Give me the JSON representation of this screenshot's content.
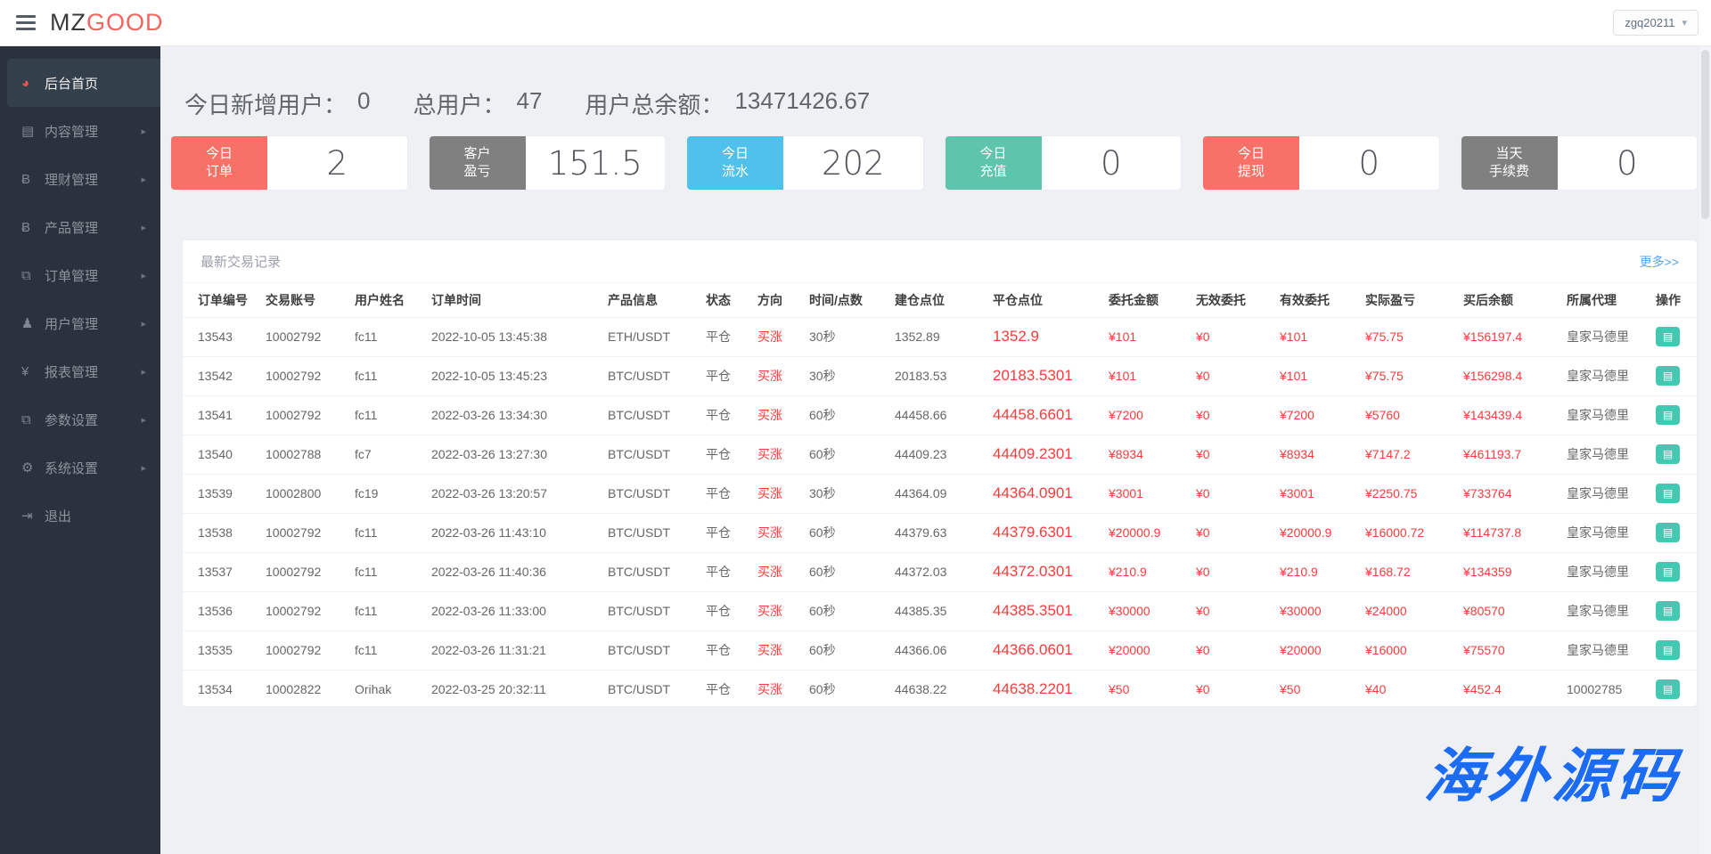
{
  "topbar": {
    "logo_prefix": "MZ",
    "logo_suffix": "GOOD",
    "user": "zgq20211"
  },
  "icons": {
    "dashboard-icon": "◕",
    "book-icon": "▤",
    "bitcoin-icon": "Ƀ",
    "files-icon": "⧉",
    "user-icon": "♟",
    "yen-icon": "¥",
    "gears-icon": "⚙",
    "signout-icon": "⇥",
    "chevron-right-icon": "▸",
    "chevron-down-icon": "▾",
    "table-icon": "▤"
  },
  "sidebar": {
    "items": [
      {
        "label": "后台首页",
        "icon": "dashboard-icon",
        "active": true
      },
      {
        "label": "内容管理",
        "icon": "book-icon",
        "expandable": true
      },
      {
        "label": "理财管理",
        "icon": "bitcoin-icon",
        "expandable": true
      },
      {
        "label": "产品管理",
        "icon": "bitcoin-icon",
        "expandable": true
      },
      {
        "label": "订单管理",
        "icon": "files-icon",
        "expandable": true
      },
      {
        "label": "用户管理",
        "icon": "user-icon",
        "expandable": true
      },
      {
        "label": "报表管理",
        "icon": "yen-icon",
        "expandable": true
      },
      {
        "label": "参数设置",
        "icon": "files-icon",
        "expandable": true
      },
      {
        "label": "系统设置",
        "icon": "gears-icon",
        "expandable": true
      },
      {
        "label": "退出",
        "icon": "signout-icon"
      }
    ]
  },
  "stats": {
    "new_users_label": "今日新增用户：",
    "new_users": "0",
    "total_users_label": "总用户：",
    "total_users": "47",
    "total_balance_label": "用户总余额：",
    "total_balance": "13471426.67"
  },
  "cards": [
    {
      "line1": "今日",
      "line2": "订单",
      "value": "2",
      "color": "#f77168"
    },
    {
      "line1": "客户",
      "line2": "盈亏",
      "value": "151.5",
      "color": "#808080"
    },
    {
      "line1": "今日",
      "line2": "流水",
      "value": "202",
      "color": "#4fc1ea"
    },
    {
      "line1": "今日",
      "line2": "充值",
      "value": "0",
      "color": "#5fc4ac"
    },
    {
      "line1": "今日",
      "line2": "提现",
      "value": "0",
      "color": "#f77168"
    },
    {
      "line1": "当天",
      "line2": "手续费",
      "value": "0",
      "color": "#808080"
    }
  ],
  "table": {
    "title": "最新交易记录",
    "more": "更多>>",
    "columns": [
      "订单编号",
      "交易账号",
      "用户姓名",
      "订单时间",
      "产品信息",
      "状态",
      "方向",
      "时间/点数",
      "建仓点位",
      "平仓点位",
      "委托金额",
      "无效委托",
      "有效委托",
      "实际盈亏",
      "买后余额",
      "所属代理",
      "操作"
    ],
    "rows": [
      {
        "id": "13543",
        "account": "10002792",
        "name": "fc11",
        "time": "2022-10-05 13:45:38",
        "product": "ETH/USDT",
        "status": "平仓",
        "direction": "买涨",
        "period": "30秒",
        "open": "1352.89",
        "close": "1352.9",
        "amount": "¥101",
        "invalid": "¥0",
        "valid": "¥101",
        "profit": "¥75.75",
        "balance": "¥156197.4",
        "agent": "皇家马德里"
      },
      {
        "id": "13542",
        "account": "10002792",
        "name": "fc11",
        "time": "2022-10-05 13:45:23",
        "product": "BTC/USDT",
        "status": "平仓",
        "direction": "买涨",
        "period": "30秒",
        "open": "20183.53",
        "close": "20183.5301",
        "amount": "¥101",
        "invalid": "¥0",
        "valid": "¥101",
        "profit": "¥75.75",
        "balance": "¥156298.4",
        "agent": "皇家马德里"
      },
      {
        "id": "13541",
        "account": "10002792",
        "name": "fc11",
        "time": "2022-03-26 13:34:30",
        "product": "BTC/USDT",
        "status": "平仓",
        "direction": "买涨",
        "period": "60秒",
        "open": "44458.66",
        "close": "44458.6601",
        "amount": "¥7200",
        "invalid": "¥0",
        "valid": "¥7200",
        "profit": "¥5760",
        "balance": "¥143439.4",
        "agent": "皇家马德里"
      },
      {
        "id": "13540",
        "account": "10002788",
        "name": "fc7",
        "time": "2022-03-26 13:27:30",
        "product": "BTC/USDT",
        "status": "平仓",
        "direction": "买涨",
        "period": "60秒",
        "open": "44409.23",
        "close": "44409.2301",
        "amount": "¥8934",
        "invalid": "¥0",
        "valid": "¥8934",
        "profit": "¥7147.2",
        "balance": "¥461193.7",
        "agent": "皇家马德里"
      },
      {
        "id": "13539",
        "account": "10002800",
        "name": "fc19",
        "time": "2022-03-26 13:20:57",
        "product": "BTC/USDT",
        "status": "平仓",
        "direction": "买涨",
        "period": "30秒",
        "open": "44364.09",
        "close": "44364.0901",
        "amount": "¥3001",
        "invalid": "¥0",
        "valid": "¥3001",
        "profit": "¥2250.75",
        "balance": "¥733764",
        "agent": "皇家马德里"
      },
      {
        "id": "13538",
        "account": "10002792",
        "name": "fc11",
        "time": "2022-03-26 11:43:10",
        "product": "BTC/USDT",
        "status": "平仓",
        "direction": "买涨",
        "period": "60秒",
        "open": "44379.63",
        "close": "44379.6301",
        "amount": "¥20000.9",
        "invalid": "¥0",
        "valid": "¥20000.9",
        "profit": "¥16000.72",
        "balance": "¥114737.8",
        "agent": "皇家马德里"
      },
      {
        "id": "13537",
        "account": "10002792",
        "name": "fc11",
        "time": "2022-03-26 11:40:36",
        "product": "BTC/USDT",
        "status": "平仓",
        "direction": "买涨",
        "period": "60秒",
        "open": "44372.03",
        "close": "44372.0301",
        "amount": "¥210.9",
        "invalid": "¥0",
        "valid": "¥210.9",
        "profit": "¥168.72",
        "balance": "¥134359",
        "agent": "皇家马德里"
      },
      {
        "id": "13536",
        "account": "10002792",
        "name": "fc11",
        "time": "2022-03-26 11:33:00",
        "product": "BTC/USDT",
        "status": "平仓",
        "direction": "买涨",
        "period": "60秒",
        "open": "44385.35",
        "close": "44385.3501",
        "amount": "¥30000",
        "invalid": "¥0",
        "valid": "¥30000",
        "profit": "¥24000",
        "balance": "¥80570",
        "agent": "皇家马德里"
      },
      {
        "id": "13535",
        "account": "10002792",
        "name": "fc11",
        "time": "2022-03-26 11:31:21",
        "product": "BTC/USDT",
        "status": "平仓",
        "direction": "买涨",
        "period": "60秒",
        "open": "44366.06",
        "close": "44366.0601",
        "amount": "¥20000",
        "invalid": "¥0",
        "valid": "¥20000",
        "profit": "¥16000",
        "balance": "¥75570",
        "agent": "皇家马德里"
      },
      {
        "id": "13534",
        "account": "10002822",
        "name": "Orihak",
        "time": "2022-03-25 20:32:11",
        "product": "BTC/USDT",
        "status": "平仓",
        "direction": "买涨",
        "period": "60秒",
        "open": "44638.22",
        "close": "44638.2201",
        "amount": "¥50",
        "invalid": "¥0",
        "valid": "¥50",
        "profit": "¥40",
        "balance": "¥452.4",
        "agent": "10002785"
      }
    ]
  },
  "watermark": "海外源码",
  "colors": {
    "accent_red": "#f4655f",
    "card_red": "#f77168",
    "card_gray": "#808080",
    "card_blue": "#4fc1ea",
    "card_teal": "#5fc4ac",
    "value_red": "#f53d3d",
    "action_teal": "#45c8b2",
    "sidebar_bg": "#2a323d",
    "watermark_blue": "#1b6cf3"
  }
}
